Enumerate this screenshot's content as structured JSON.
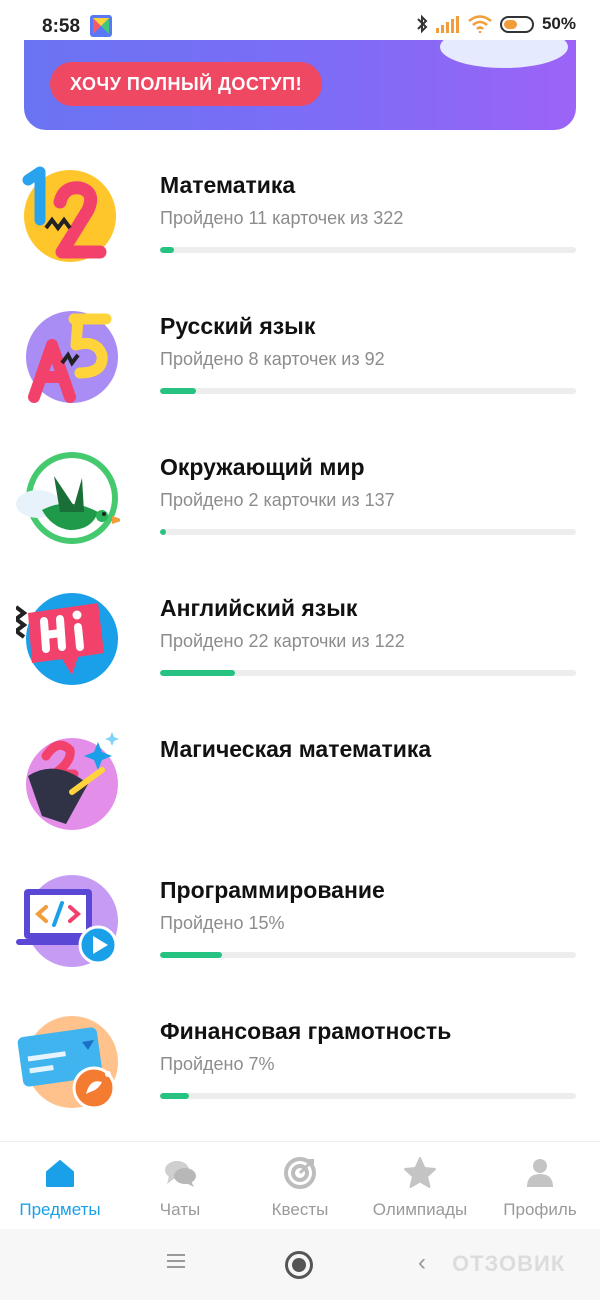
{
  "status_bar": {
    "time": "8:58",
    "battery_text": "50%",
    "battery_level": 0.5,
    "icons": [
      "bluetooth-icon",
      "signal-icon",
      "wifi-icon",
      "battery-icon"
    ]
  },
  "promo": {
    "button_label": "ХОЧУ ПОЛНЫЙ ДОСТУП!"
  },
  "subjects": [
    {
      "title": "Математика",
      "progress_text": "Пройдено 11 карточек из 322",
      "progress": 0.034,
      "icon": "numbers-icon"
    },
    {
      "title": "Русский язык",
      "progress_text": "Пройдено 8 карточек из 92",
      "progress": 0.087,
      "icon": "letters-icon"
    },
    {
      "title": "Окружающий мир",
      "progress_text": "Пройдено 2 карточки из 137",
      "progress": 0.015,
      "icon": "bird-icon"
    },
    {
      "title": "Английский язык",
      "progress_text": "Пройдено 22 карточки из 122",
      "progress": 0.18,
      "icon": "hi-bubble-icon"
    },
    {
      "title": "Магическая математика",
      "progress_text": "",
      "progress": null,
      "icon": "magic-hat-icon"
    },
    {
      "title": "Программирование",
      "progress_text": "Пройдено 15%",
      "progress": 0.15,
      "icon": "code-laptop-icon"
    },
    {
      "title": "Финансовая грамотность",
      "progress_text": "Пройдено 7%",
      "progress": 0.07,
      "icon": "credit-card-icon"
    }
  ],
  "bottom_nav": [
    {
      "label": "Предметы",
      "icon": "home-icon",
      "active": true
    },
    {
      "label": "Чаты",
      "icon": "chat-icon",
      "active": false
    },
    {
      "label": "Квесты",
      "icon": "target-icon",
      "active": false
    },
    {
      "label": "Олимпиады",
      "icon": "star-icon",
      "active": false
    },
    {
      "label": "Профиль",
      "icon": "person-icon",
      "active": false
    }
  ],
  "watermark": "ОТЗОВИК",
  "colors": {
    "accent": "#1aa0e8",
    "progress": "#26c281",
    "promo_button": "#ee4863",
    "promo_gradient_start": "#6a74f3",
    "promo_gradient_end": "#9c63f7"
  }
}
